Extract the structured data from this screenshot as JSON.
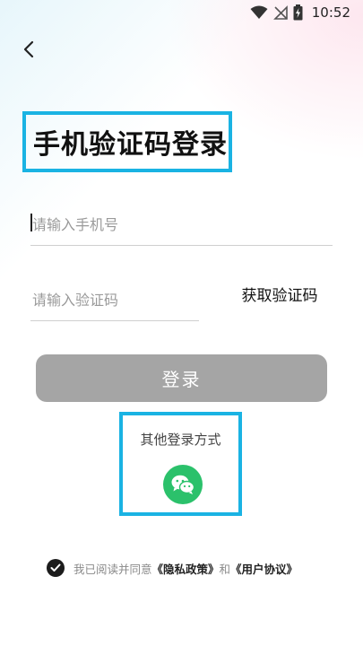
{
  "status_bar": {
    "time": "10:52",
    "icons": [
      "wifi-icon",
      "no-signal-icon",
      "battery-charging-icon"
    ]
  },
  "nav": {
    "back_icon": "chevron-left-icon"
  },
  "page_title": "手机验证码登录",
  "phone_field": {
    "placeholder": "请输入手机号",
    "value": ""
  },
  "code_field": {
    "placeholder": "请输入验证码",
    "value": ""
  },
  "get_code_label": "获取验证码",
  "login_button_label": "登录",
  "other_login": {
    "label": "其他登录方式",
    "wechat_icon": "wechat-icon"
  },
  "agreement": {
    "checked": true,
    "prefix": "我已阅读并同意",
    "privacy_link": "《隐私政策》",
    "connector": "和",
    "terms_link": "《用户协议》"
  },
  "colors": {
    "highlight_border": "#1ab3e3",
    "login_button_bg": "#a5a5a5",
    "wechat_green": "#2bc16b"
  }
}
